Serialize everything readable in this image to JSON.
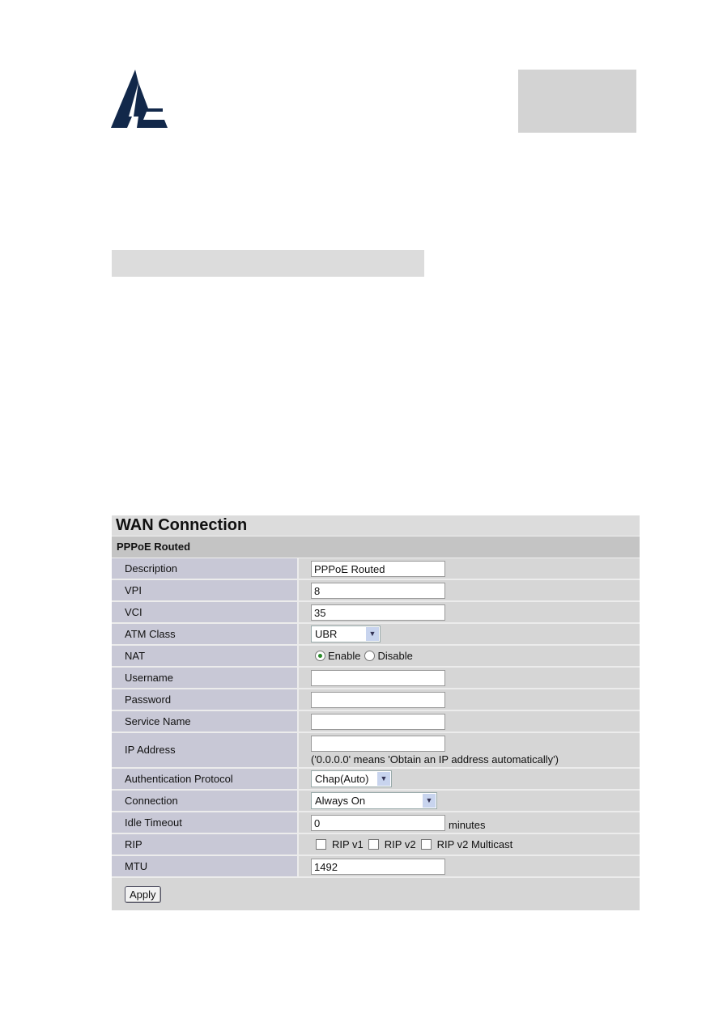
{
  "logo": {
    "name": "atlantis-logo-icon",
    "color": "#12284a"
  },
  "wan": {
    "title": "WAN Connection",
    "section": "PPPoE Routed",
    "fields": {
      "description": {
        "label": "Description",
        "value": "PPPoE Routed"
      },
      "vpi": {
        "label": "VPI",
        "value": "8"
      },
      "vci": {
        "label": "VCI",
        "value": "35"
      },
      "atm_class": {
        "label": "ATM Class",
        "value": "UBR"
      },
      "nat": {
        "label": "NAT",
        "options": [
          "Enable",
          "Disable"
        ],
        "selected": "Enable"
      },
      "username": {
        "label": "Username",
        "value": ""
      },
      "password": {
        "label": "Password",
        "value": ""
      },
      "service_name": {
        "label": "Service Name",
        "value": ""
      },
      "ip_address": {
        "label": "IP Address",
        "value": "",
        "hint": "('0.0.0.0' means 'Obtain an IP address automatically')"
      },
      "auth_protocol": {
        "label": "Authentication Protocol",
        "value": "Chap(Auto)"
      },
      "connection": {
        "label": "Connection",
        "value": "Always On"
      },
      "idle_timeout": {
        "label": "Idle Timeout",
        "value": "0",
        "unit": "minutes"
      },
      "rip": {
        "label": "RIP",
        "options": [
          "RIP v1",
          "RIP v2",
          "RIP v2 Multicast"
        ],
        "checked": [
          false,
          false,
          false
        ]
      },
      "mtu": {
        "label": "MTU",
        "value": "1492"
      }
    },
    "apply_label": "Apply"
  }
}
